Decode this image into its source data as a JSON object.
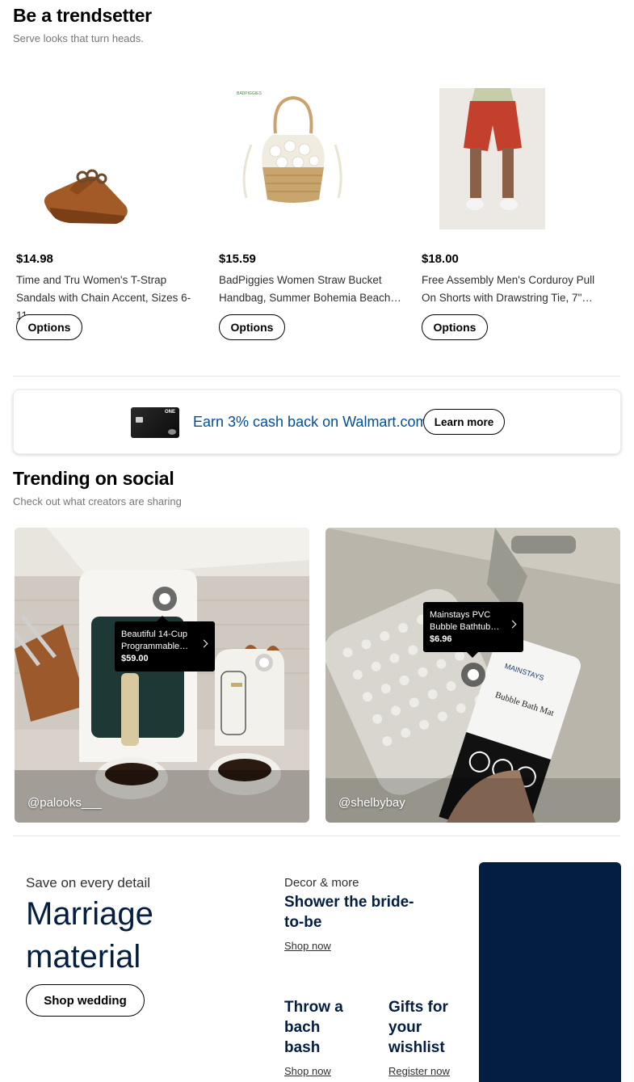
{
  "trendsetter": {
    "title": "Be a trendsetter",
    "subtitle": "Serve looks that turn heads.",
    "products": [
      {
        "price": "$14.98",
        "name": "Time and Tru Women's T-Strap Sandals with Chain Accent, Sizes 6-11",
        "button": "Options"
      },
      {
        "price": "$15.59",
        "name": "BadPiggies Women Straw Bucket Handbag, Summer Bohemia Beach…",
        "button": "Options"
      },
      {
        "price": "$18.00",
        "name": "Free Assembly Men's Corduroy Pull On Shorts with Drawstring Tie, 7\"…",
        "button": "Options"
      }
    ]
  },
  "promo": {
    "text": "Earn 3% cash back on Walmart.com",
    "button": "Learn more",
    "card_badge": "ONE"
  },
  "social": {
    "title": "Trending on social",
    "subtitle": "Check out what creators are sharing",
    "posts": [
      {
        "handle": "@palooks___",
        "product_name": "Beautiful 14-Cup Programmable…",
        "product_price": "$59.00"
      },
      {
        "handle": "@shelbybay",
        "product_name": "Mainstays PVC Bubble Bathtub…",
        "product_price": "$6.96",
        "bottle_brand": "MAINSTAYS",
        "bottle_label": "Bubble Bath Mat"
      }
    ]
  },
  "wedding": {
    "kicker": "Save on every detail",
    "title": "Marriage material",
    "button": "Shop wedding",
    "tiles": [
      {
        "kicker": "Decor & more",
        "title": "Shower the bride-to-be",
        "link": "Shop now"
      },
      {
        "title": "Throw a bach bash",
        "link": "Shop now"
      },
      {
        "title": "Gifts for your wishlist",
        "link": "Register now"
      }
    ]
  },
  "colors": {
    "navy": "#041e42",
    "link_blue": "#004f9a",
    "muted_text": "#74767c"
  }
}
